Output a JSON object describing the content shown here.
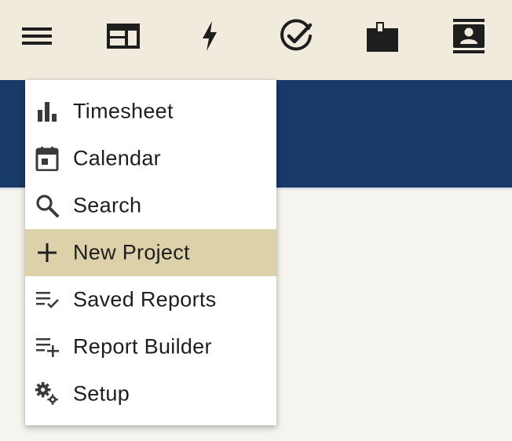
{
  "toolbar": {
    "icons": [
      {
        "name": "hamburger-menu-icon"
      },
      {
        "name": "dashboard-icon"
      },
      {
        "name": "lightning-icon"
      },
      {
        "name": "check-circle-icon"
      },
      {
        "name": "briefcase-icon"
      },
      {
        "name": "contacts-icon"
      }
    ]
  },
  "menu": {
    "items": [
      {
        "label": "Timesheet",
        "icon": "bar-chart-icon",
        "active": false
      },
      {
        "label": "Calendar",
        "icon": "calendar-icon",
        "active": false
      },
      {
        "label": "Search",
        "icon": "search-icon",
        "active": false
      },
      {
        "label": "New Project",
        "icon": "plus-icon",
        "active": true
      },
      {
        "label": "Saved Reports",
        "icon": "playlist-check-icon",
        "active": false
      },
      {
        "label": "Report Builder",
        "icon": "playlist-add-icon",
        "active": false
      },
      {
        "label": "Setup",
        "icon": "gears-icon",
        "active": false
      }
    ]
  },
  "colors": {
    "toolbar_bg": "#f1ebde",
    "header_band": "#173a6b",
    "page_bg": "#f6f4ee",
    "menu_highlight": "#ddd1a9",
    "icon": "#1e1e1e"
  }
}
